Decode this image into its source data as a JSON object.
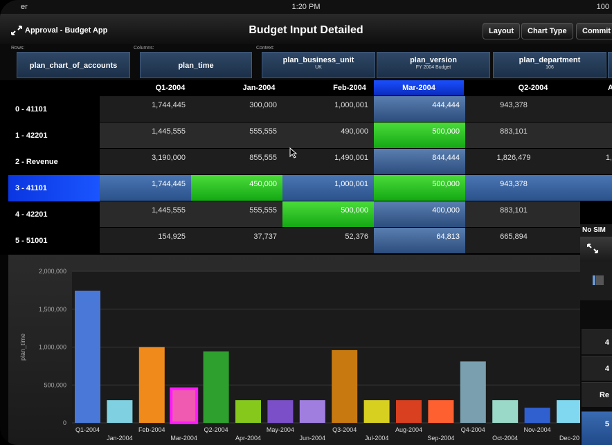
{
  "status": {
    "carrier": "er",
    "time": "1:20 PM",
    "battery": "100"
  },
  "header": {
    "app_title": "Approval - Budget App",
    "page_title": "Budget Input Detailed",
    "buttons": [
      "Layout",
      "Chart Type",
      "Commit"
    ]
  },
  "dimensions": {
    "rows_label": "Rows:",
    "columns_label": "Columns:",
    "context_label": "Context:",
    "row_dim": "plan_chart_of_accounts",
    "col_dim": "plan_time",
    "context": [
      {
        "name": "plan_business_unit",
        "value": "UK"
      },
      {
        "name": "plan_version",
        "value": "FY 2004 Budget"
      },
      {
        "name": "plan_department",
        "value": "106"
      }
    ]
  },
  "grid": {
    "columns": [
      "Q1-2004",
      "Jan-2004",
      "Feb-2004",
      "Mar-2004",
      "Q2-2004",
      "A"
    ],
    "rows": [
      {
        "label": "0 - 41101",
        "values": [
          "1,744,445",
          "300,000",
          "1,000,001",
          "444,444",
          "943,378"
        ]
      },
      {
        "label": "1 - 42201",
        "values": [
          "1,445,555",
          "555,555",
          "490,000",
          "500,000",
          "883,101"
        ]
      },
      {
        "label": "2 - Revenue",
        "values": [
          "3,190,000",
          "855,555",
          "1,490,001",
          "844,444",
          "1,826,479",
          "1,"
        ]
      },
      {
        "label": "3 - 41101",
        "values": [
          "1,744,445",
          "450,000",
          "1,000,001",
          "500,000",
          "943,378"
        ]
      },
      {
        "label": "4 - 42201",
        "values": [
          "1,445,555",
          "555,555",
          "500,000",
          "400,000",
          "883,101"
        ]
      },
      {
        "label": "5 - 51001",
        "values": [
          "154,925",
          "37,737",
          "52,376",
          "64,813",
          "665,894"
        ]
      }
    ]
  },
  "side_panel": {
    "nosim": "No SIM",
    "items": [
      "4",
      "4",
      "Re",
      "5"
    ]
  },
  "chart_data": {
    "type": "bar",
    "ylabel": "plan_time",
    "ylim": [
      0,
      2000000
    ],
    "yticks": [
      "0",
      "500,000",
      "1,000,000",
      "1,500,000",
      "2,000,000"
    ],
    "categories": [
      "Q1-2004",
      "Jan-2004",
      "Feb-2004",
      "Mar-2004",
      "Q2-2004",
      "Apr-2004",
      "May-2004",
      "Jun-2004",
      "Q3-2004",
      "Jul-2004",
      "Aug-2004",
      "Sep-2004",
      "Q4-2004",
      "Oct-2004",
      "Nov-2004",
      "Dec-20"
    ],
    "values": [
      1744445,
      300000,
      1000001,
      450000,
      943378,
      300000,
      300000,
      300000,
      960000,
      300000,
      300000,
      300000,
      810000,
      300000,
      200000,
      300000
    ],
    "colors": [
      "#4a78d8",
      "#7fd0e0",
      "#f08a1a",
      "#f05ab0",
      "#2ea02e",
      "#86c81c",
      "#7a4fc8",
      "#a07ee0",
      "#c87a10",
      "#d8d020",
      "#d84020",
      "#ff6030",
      "#7aa0b0",
      "#9ad8c8",
      "#3060d0",
      "#80d8f0"
    ],
    "selected_index": 3
  }
}
